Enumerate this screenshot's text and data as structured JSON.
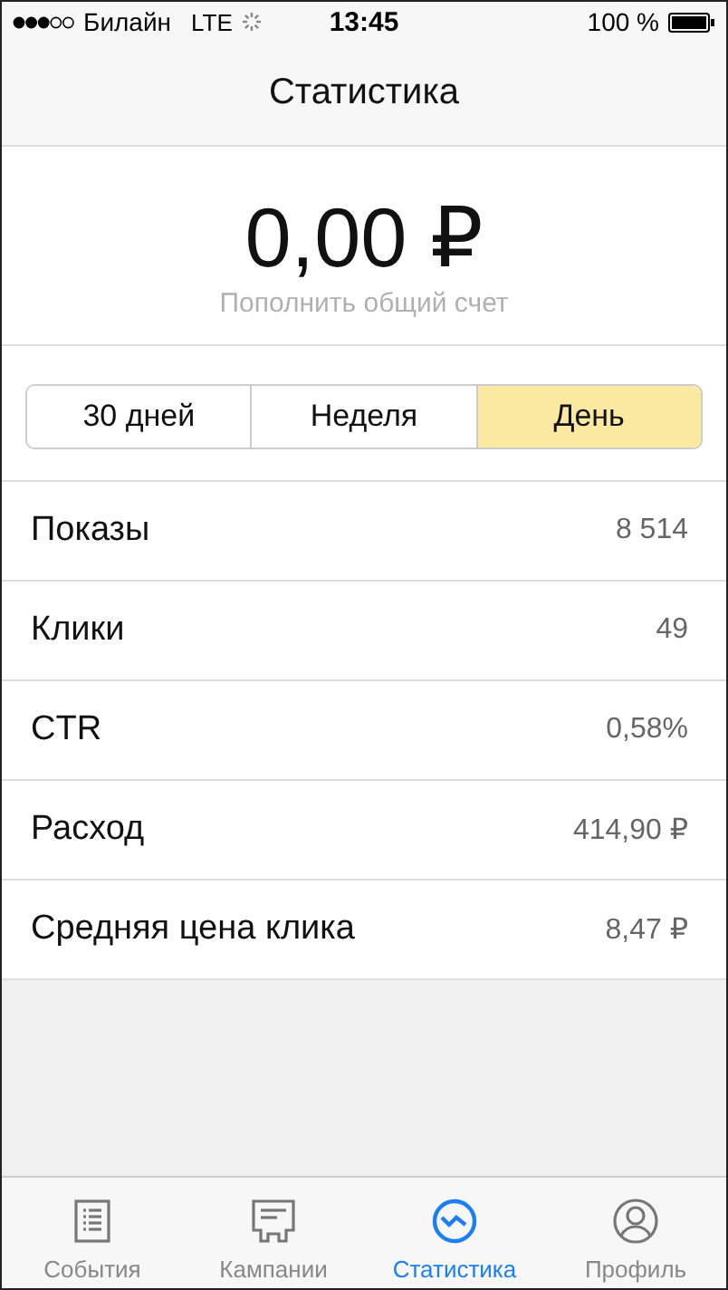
{
  "status_bar": {
    "carrier": "Билайн",
    "network": "LTE",
    "time": "13:45",
    "battery": "100 %"
  },
  "nav": {
    "title": "Статистика"
  },
  "balance": {
    "amount": "0,00 ₽",
    "link": "Пополнить общий счет"
  },
  "periods": [
    {
      "label": "30 дней",
      "selected": false
    },
    {
      "label": "Неделя",
      "selected": false
    },
    {
      "label": "День",
      "selected": true
    }
  ],
  "stats": [
    {
      "label": "Показы",
      "value": "8 514"
    },
    {
      "label": "Клики",
      "value": "49"
    },
    {
      "label": "CTR",
      "value": "0,58%"
    },
    {
      "label": "Расход",
      "value": "414,90 ₽"
    },
    {
      "label": "Средняя цена клика",
      "value": "8,47 ₽"
    }
  ],
  "tab_bar": [
    {
      "kind": "events",
      "label": "События",
      "selected": false
    },
    {
      "kind": "campaigns",
      "label": "Кампании",
      "selected": false
    },
    {
      "kind": "stats",
      "label": "Статистика",
      "selected": true
    },
    {
      "kind": "profile",
      "label": "Профиль",
      "selected": false
    }
  ]
}
